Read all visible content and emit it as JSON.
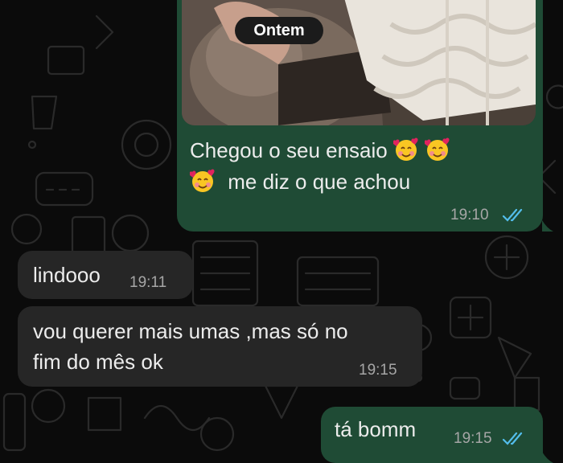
{
  "chat": {
    "date_chip": "Ontem",
    "messages": [
      {
        "direction": "outgoing",
        "has_photo": true,
        "line1": "Chegou o seu ensaio",
        "line2": "me diz o que achou",
        "time": "19:10",
        "status": "read"
      },
      {
        "direction": "incoming",
        "text": "lindooo",
        "time": "19:11"
      },
      {
        "direction": "incoming",
        "line1": "vou querer mais umas ,mas só no",
        "line2": "fim do mês  ok",
        "time": "19:15"
      },
      {
        "direction": "outgoing",
        "text": "tá bomm",
        "time": "19:15",
        "status": "read"
      }
    ]
  },
  "colors": {
    "background": "#0b0b0b",
    "outgoing_bubble": "#1f4b35",
    "incoming_bubble": "#262626",
    "read_ticks": "#53bdeb"
  },
  "icons": [
    "smiling-face-with-hearts-icon",
    "double-check-read-icon"
  ]
}
